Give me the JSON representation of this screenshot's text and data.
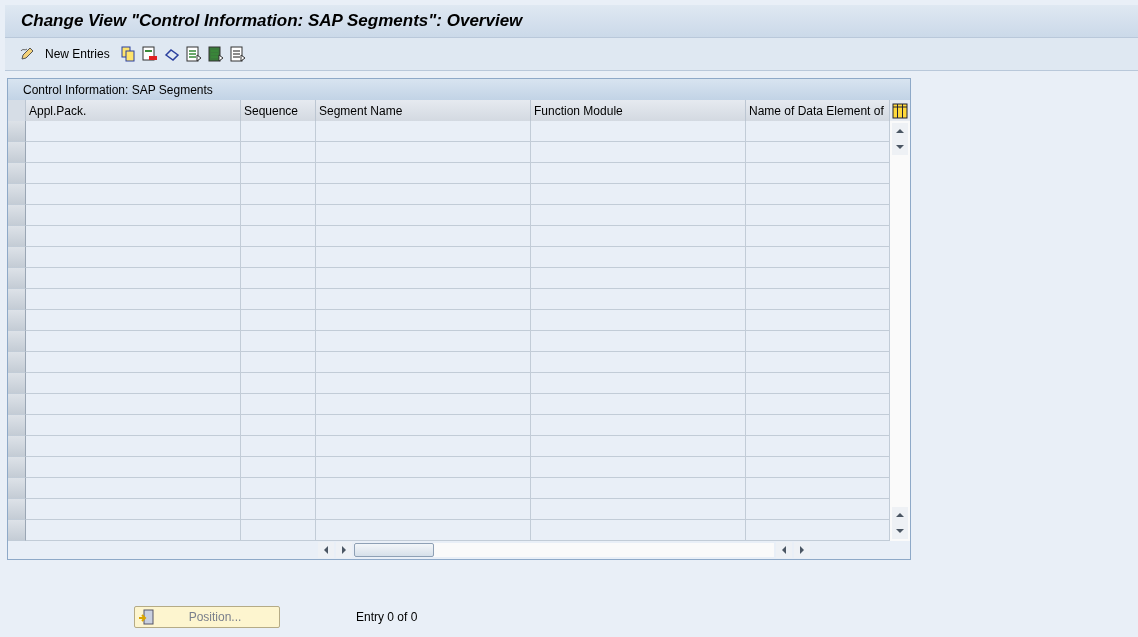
{
  "window": {
    "title": "Change View \"Control Information: SAP Segments\": Overview"
  },
  "toolbar": {
    "new_entries": "New Entries"
  },
  "table": {
    "title": "Control Information: SAP Segments",
    "columns": [
      "Appl.Pack.",
      "Sequence",
      "Segment Name",
      "Function Module",
      "Name of Data Element of"
    ]
  },
  "footer": {
    "position_button": "Position...",
    "entry_count": "Entry 0 of 0"
  }
}
